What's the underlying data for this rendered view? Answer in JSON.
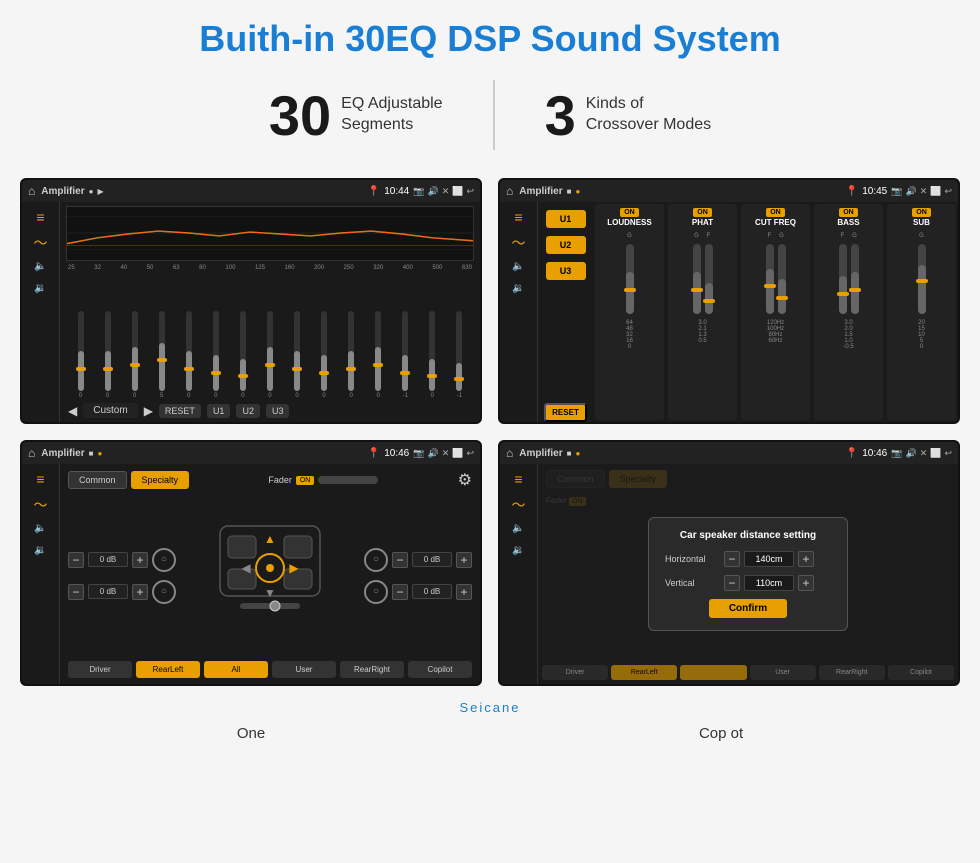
{
  "page": {
    "title": "Buith-in 30EQ DSP Sound System"
  },
  "stats": [
    {
      "number": "30",
      "desc": "EQ Adjustable\nSegments"
    },
    {
      "number": "3",
      "desc": "Kinds of\nCrossover Modes"
    }
  ],
  "screens": [
    {
      "id": "eq-screen",
      "topbar": {
        "title": "Amplifier",
        "time": "10:44"
      },
      "type": "eq"
    },
    {
      "id": "crossover-screen",
      "topbar": {
        "title": "Amplifier",
        "time": "10:45"
      },
      "type": "crossover"
    },
    {
      "id": "speaker-screen",
      "topbar": {
        "title": "Amplifier",
        "time": "10:46"
      },
      "type": "speaker"
    },
    {
      "id": "dialog-screen",
      "topbar": {
        "title": "Amplifier",
        "time": "10:46"
      },
      "type": "dialog"
    }
  ],
  "eq": {
    "frequencies": [
      "25",
      "32",
      "40",
      "50",
      "63",
      "80",
      "100",
      "125",
      "160",
      "200",
      "250",
      "320",
      "400",
      "500",
      "630"
    ],
    "bottomLabel": "Custom",
    "buttons": [
      "RESET",
      "U1",
      "U2",
      "U3"
    ],
    "sliderValues": [
      50,
      45,
      55,
      60,
      50,
      45,
      40,
      55,
      50,
      45,
      50,
      55,
      45,
      40,
      35
    ]
  },
  "crossover": {
    "uButtons": [
      "U1",
      "U2",
      "U3"
    ],
    "resetLabel": "RESET",
    "columns": [
      {
        "name": "LOUDNESS",
        "on": true
      },
      {
        "name": "PHAT",
        "on": true
      },
      {
        "name": "CUT FREQ",
        "on": true
      },
      {
        "name": "BASS",
        "on": true
      },
      {
        "name": "SUB",
        "on": true
      }
    ]
  },
  "speaker": {
    "tabs": [
      "Common",
      "Specialty"
    ],
    "activeTab": "Specialty",
    "faderLabel": "Fader",
    "faderOn": "ON",
    "dbValues": [
      "0 dB",
      "0 dB",
      "0 dB",
      "0 dB"
    ],
    "bottomButtons": [
      "Driver",
      "RearLeft",
      "All",
      "User",
      "RearRight",
      "Copilot"
    ]
  },
  "dialog": {
    "title": "Car speaker distance setting",
    "horizontal": {
      "label": "Horizontal",
      "value": "140cm"
    },
    "vertical": {
      "label": "Vertical",
      "value": "110cm"
    },
    "confirmLabel": "Confirm"
  },
  "brand": "Seicane",
  "bottomLabels": [
    "One",
    "Cop ot"
  ]
}
